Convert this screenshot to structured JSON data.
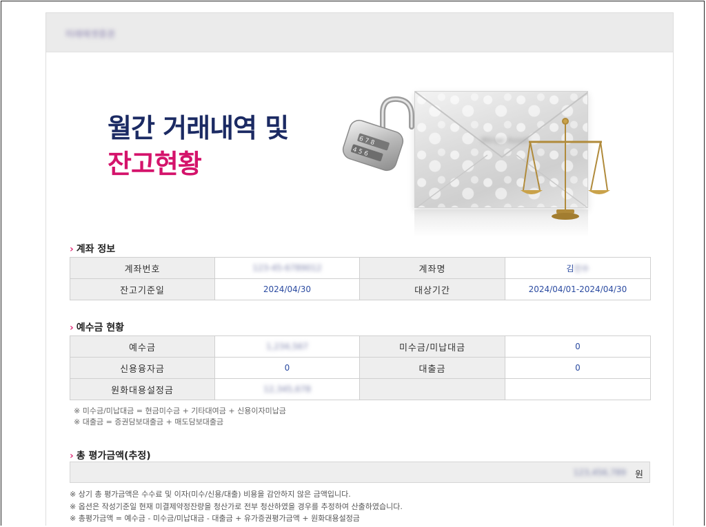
{
  "header": {
    "brand_text": "미래에셋증권"
  },
  "hero": {
    "title_line1": "월간 거래내역 및",
    "title_line2": "잔고현황",
    "envelope_label": "Mirae Asset",
    "colors": {
      "navy": "#1b2a63",
      "pink": "#d4136b"
    }
  },
  "account": {
    "section_title": "계좌 정보",
    "rows": [
      {
        "label1": "계좌번호",
        "value1": "123-45-6789012",
        "label2": "계좌명",
        "value2_visible": "김",
        "value2_hidden": "민수"
      },
      {
        "label1": "잔고기준일",
        "value1": "2024/04/30",
        "label2": "대상기간",
        "value2": "2024/04/01-2024/04/30"
      }
    ]
  },
  "deposit": {
    "section_title": "예수금 현황",
    "rows": [
      {
        "label1": "예수금",
        "value1": "1,234,567",
        "label2": "미수금/미납대금",
        "value2": "0"
      },
      {
        "label1": "신용융자금",
        "value1": "0",
        "label2": "대출금",
        "value2": "0"
      },
      {
        "label1": "원화대용설정금",
        "value1": "12,345,678",
        "label2": "",
        "value2": ""
      }
    ],
    "notes": [
      "※ 미수금/미납대금 = 현금미수금 + 기타대여금 + 신용이자미납금",
      "※ 대출금 = 증권담보대출금 + 매도담보대출금"
    ]
  },
  "total": {
    "section_title": "총 평가금액(추정)",
    "amount": "123,456,789",
    "unit": "원",
    "notes": [
      "※ 상기 총 평가금액은 수수료 및 이자(미수/신용/대출) 비용을 감안하지 않은 금액입니다.",
      "※ 옵션은 작성기준일 현재 미결제약정잔량을 청산가로 전부 청산하였을 경우를 추정하여 산출하였습니다.",
      "※ 총평가금액 = 예수금 - 미수금/미납대금 - 대출금 + 유가증권평가금액 + 원화대용설정금"
    ]
  },
  "icons": [
    "padlock-icon",
    "envelope-image",
    "scale-icon",
    "section-arrow-icon"
  ]
}
